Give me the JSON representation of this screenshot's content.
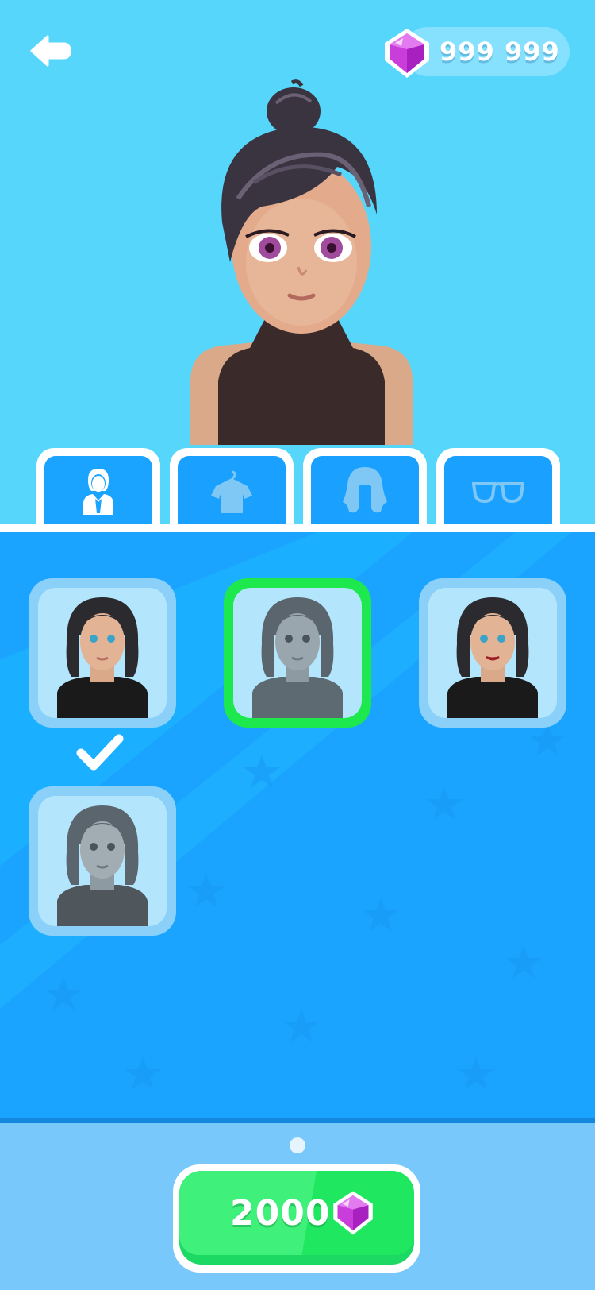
{
  "header": {
    "back_icon": "back-arrow-icon",
    "gems": {
      "icon": "diamond-icon",
      "amount": "999 999"
    }
  },
  "preview": {
    "avatar": "character-preview"
  },
  "tabs": [
    {
      "name": "body",
      "icon": "person-icon",
      "active": true
    },
    {
      "name": "clothes",
      "icon": "shirt-icon",
      "active": false
    },
    {
      "name": "hair",
      "icon": "hair-icon",
      "active": false
    },
    {
      "name": "glasses",
      "icon": "glasses-icon",
      "active": false
    }
  ],
  "grid": {
    "items": [
      {
        "variant": "natural-blue-eyes",
        "state": "equipped"
      },
      {
        "variant": "grey-locked",
        "state": "selected"
      },
      {
        "variant": "natural-red-lips",
        "state": "available"
      },
      {
        "variant": "grey-locked",
        "state": "available"
      }
    ],
    "equipped_icon": "checkmark-icon"
  },
  "footer": {
    "page_indicator": "page-dot",
    "buy": {
      "price": "2000",
      "icon": "diamond-icon"
    }
  },
  "colors": {
    "sky": "#57d6fc",
    "panel": "#1aa4ff",
    "tab": "#1aa0ff",
    "card": "#8ad0f8",
    "card_inner": "#b3e6fc",
    "selected": "#1de84e",
    "footer": "#79c8fb",
    "button": "#3ff07a",
    "gem": "#c93ddb"
  }
}
